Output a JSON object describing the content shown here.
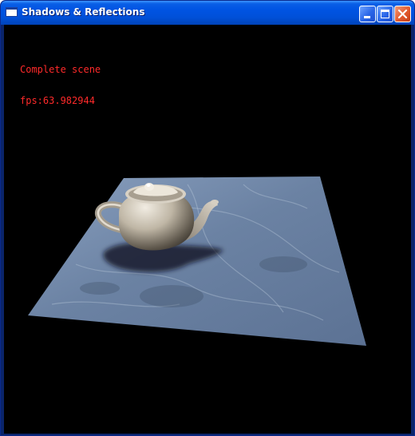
{
  "window": {
    "title": "Shadows & Reflections",
    "icons": {
      "app": "app-window-icon",
      "minimize": "minimize-icon",
      "maximize": "maximize-icon",
      "close": "close-icon"
    },
    "colors": {
      "titlebar": "#0054e3",
      "close_button": "#e25a2e"
    }
  },
  "scene": {
    "hud": {
      "mode_text": "Complete scene",
      "fps_text": "fps:63.982944",
      "color": "#ff2a2a"
    },
    "background_color": "#000000",
    "floor_color": "#6f86a6",
    "object": "teapot"
  }
}
